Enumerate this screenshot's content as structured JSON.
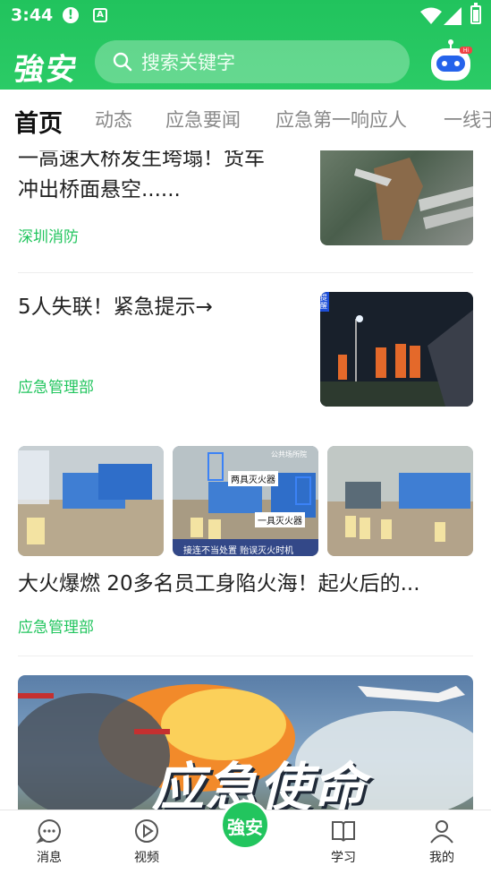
{
  "status": {
    "time": "3:44",
    "alert": "!",
    "app": "A"
  },
  "header": {
    "logo": "強安",
    "search_placeholder": "搜索关键字",
    "accent": "#22c55e"
  },
  "tabs": [
    {
      "label": "首页",
      "active": true
    },
    {
      "label": "动态"
    },
    {
      "label": "应急要闻"
    },
    {
      "label": "应急第一响应人"
    },
    {
      "label": "一线于"
    }
  ],
  "feed": [
    {
      "title_line1": "一高速大桥发生垮塌！货车",
      "title_line2": "冲出桥面悬空......",
      "source": "深圳消防"
    },
    {
      "title": "5人失联！紧急提示→",
      "source": "应急管理部",
      "badge": "提醒"
    },
    {
      "title": "大火爆燃 20多名员工身陷火海！起火后的...",
      "source": "应急管理部",
      "captions": [
        "两具灭火器",
        "一具灭火器",
        "接连不当处置 贻误灭火时机",
        "公共场所院"
      ]
    },
    {
      "banner_text": "应急使命"
    }
  ],
  "bottom_nav": [
    {
      "label": "消息",
      "icon": "message-icon"
    },
    {
      "label": "视频",
      "icon": "play-icon"
    },
    {
      "label": "強安",
      "icon": "home-logo-icon"
    },
    {
      "label": "学习",
      "icon": "book-icon"
    },
    {
      "label": "我的",
      "icon": "user-icon"
    }
  ]
}
